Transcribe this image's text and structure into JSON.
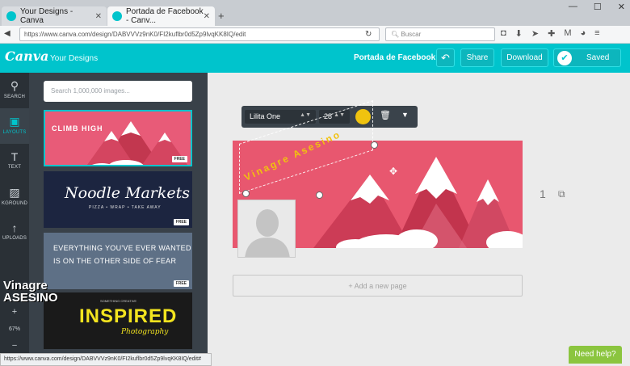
{
  "browser": {
    "tabs": [
      {
        "label": "Your Designs - Canva"
      },
      {
        "label": "Portada de Facebook - Canv..."
      }
    ],
    "url": "https://www.canva.com/design/DABVVVz9nK0/FI2kuflbr0d5Zp9lvqKK8IQ/edit",
    "search_placeholder": "Buscar",
    "status_url": "https://www.canva.com/design/DABVVVz9nK0/FI2kuflbr0d5Zp9lvqKK8IQ/edit#"
  },
  "header": {
    "logo": "Canva",
    "your_designs": "Your Designs",
    "design_title": "Portada de Facebook",
    "share_label": "Share",
    "download_label": "Download",
    "saved_label": "Saved"
  },
  "rail": {
    "items": [
      {
        "label": "SEARCH"
      },
      {
        "label": "LAYOUTS"
      },
      {
        "label": "TEXT"
      },
      {
        "label": "KGROUND"
      },
      {
        "label": "UPLOADS"
      }
    ],
    "zoom_plus": "+",
    "zoom_level": "67%",
    "zoom_minus": "–"
  },
  "panel": {
    "search_placeholder": "Search 1,000,000 images...",
    "free_badge": "FREE",
    "layouts": [
      {
        "title": "CLIMB HIGH"
      },
      {
        "title": "Noodle Markets",
        "subtitle": "PIZZA • WRAP • TAKE AWAY"
      },
      {
        "line1": "EVERYTHING YOU'VE EVER WANTED",
        "line2": "IS ON THE OTHER SIDE OF FEAR"
      },
      {
        "top": "SOMETHING CREATIVE",
        "title": "INSPIRED",
        "subtitle": "Photography"
      }
    ]
  },
  "watermark": {
    "line1": "Vinagre",
    "line2": "ASESINO"
  },
  "toolbar": {
    "font_name": "Lilita One",
    "font_size": "28",
    "text_color": "#f0c30f"
  },
  "canvas": {
    "headline_text": "Vinagre Asesino",
    "page_number": "1",
    "add_page_label": "+ Add a new page"
  },
  "help_label": "Need help?",
  "colors": {
    "brand": "#00c4cc",
    "design_bg": "#e8576f",
    "help": "#8bc53f"
  }
}
